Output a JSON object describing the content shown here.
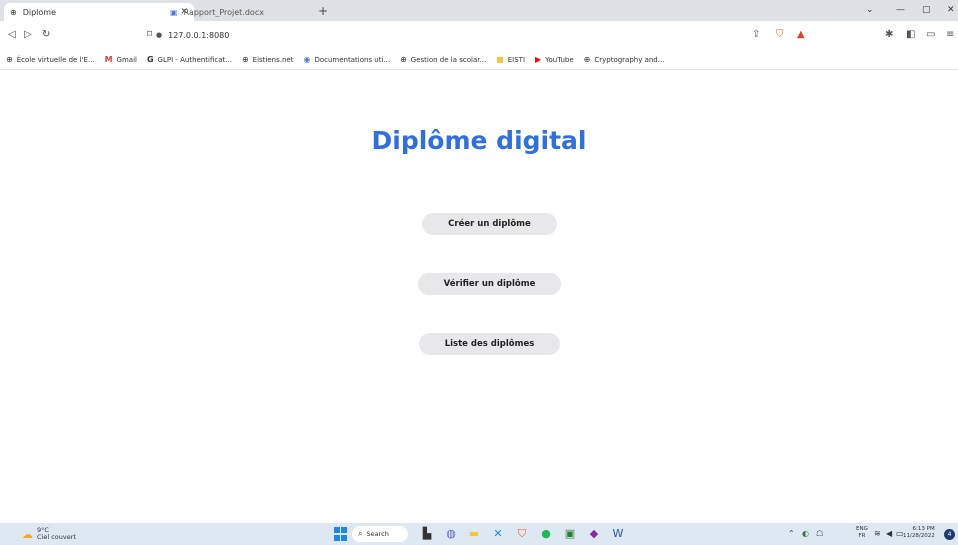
{
  "browser": {
    "tabs": [
      {
        "title": "Diplome",
        "icon": "globe-icon",
        "active": true
      },
      {
        "title": "Rapport_Projet.docx",
        "icon": "word-doc-icon",
        "active": false
      }
    ],
    "address": "127.0.0.1:8080",
    "bookmarks": [
      {
        "label": "École virtuelle de l'E...",
        "icon": "globe-icon"
      },
      {
        "label": "Gmail",
        "icon": "gmail-icon"
      },
      {
        "label": "GLPI - Authentificat...",
        "icon": "g-icon"
      },
      {
        "label": "Eistiens.net",
        "icon": "globe-icon"
      },
      {
        "label": "Documentations uti...",
        "icon": "docs-icon"
      },
      {
        "label": "Gestion de la scolar...",
        "icon": "globe-icon"
      },
      {
        "label": "EISTI",
        "icon": "folder-icon"
      },
      {
        "label": "YouTube",
        "icon": "youtube-icon"
      },
      {
        "label": "Cryptography and...",
        "icon": "globe-icon"
      }
    ]
  },
  "page": {
    "title": "Diplôme digital",
    "buttons": {
      "create": "Créer un diplôme",
      "verify": "Vérifier un diplôme",
      "list": "Liste des diplômes"
    },
    "title_color": "#2f6fe0"
  },
  "taskbar": {
    "weather_temp": "9°C",
    "weather_desc": "Ciel couvert",
    "search_label": "Search",
    "lang_top": "ENG",
    "lang_bottom": "FR",
    "time": "6:13 PM",
    "date": "11/28/2022",
    "notification_count": "4"
  }
}
